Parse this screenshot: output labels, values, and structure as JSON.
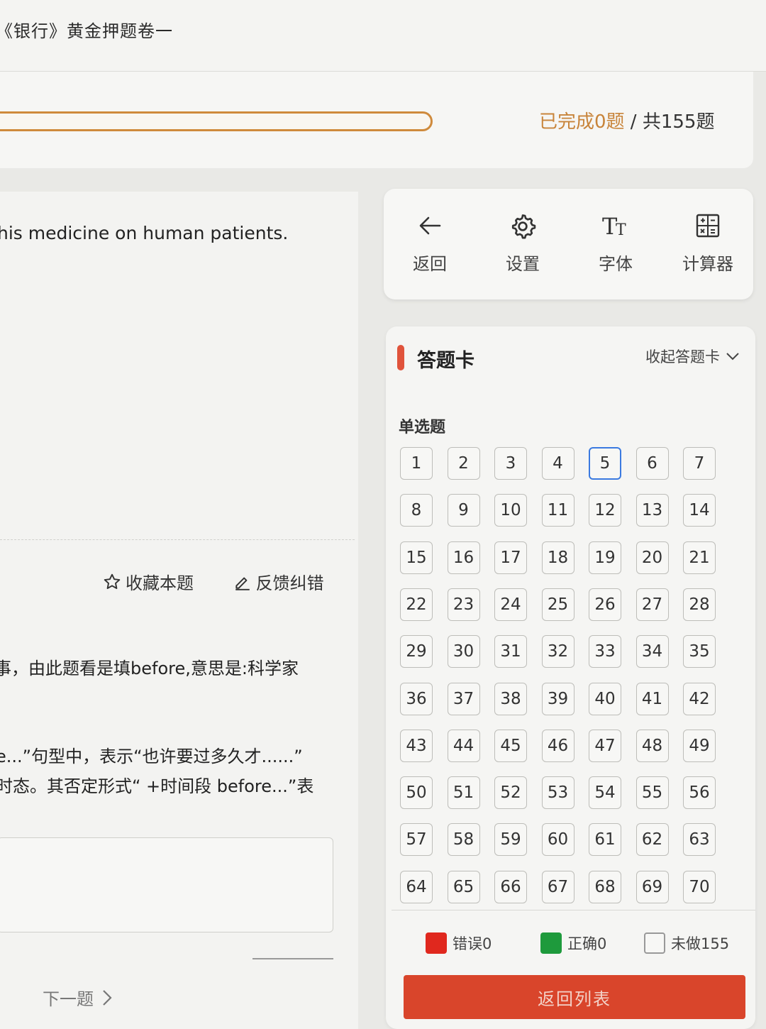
{
  "header": {
    "title": "《银行》黄金押题卷一"
  },
  "progress": {
    "done_text": "已完成0题",
    "total_text": " / 共155题",
    "fraction": 0
  },
  "question": {
    "text": "his medicine on human patients."
  },
  "actions": {
    "favorite_label": "收藏本题",
    "feedback_label": "反馈纠错"
  },
  "explanation": {
    "line1": "事，由此题看是填before,意思是:科学家",
    "line2": "e...”句型中，表示“也许要过多久才......”",
    "line3": "时态。其否定形式“ +时间段 before...”表"
  },
  "nav": {
    "next_label": "下一题"
  },
  "toolbar": {
    "back": "返回",
    "settings": "设置",
    "font": "字体",
    "calculator": "计算器"
  },
  "answer_card": {
    "title": "答题卡",
    "collapse_label": "收起答题卡",
    "section_label": "单选题",
    "current": 5,
    "questions": [
      "1",
      "2",
      "3",
      "4",
      "5",
      "6",
      "7",
      "8",
      "9",
      "10",
      "11",
      "12",
      "13",
      "14",
      "15",
      "16",
      "17",
      "18",
      "19",
      "20",
      "21",
      "22",
      "23",
      "24",
      "25",
      "26",
      "27",
      "28",
      "29",
      "30",
      "31",
      "32",
      "33",
      "34",
      "35",
      "36",
      "37",
      "38",
      "39",
      "40",
      "41",
      "42",
      "43",
      "44",
      "45",
      "46",
      "47",
      "48",
      "49",
      "50",
      "51",
      "52",
      "53",
      "54",
      "55",
      "56",
      "57",
      "58",
      "59",
      "60",
      "61",
      "62",
      "63",
      "64",
      "65",
      "66",
      "67",
      "68",
      "69",
      "70"
    ]
  },
  "legend": {
    "wrong": "错误0",
    "correct": "正确0",
    "undone": "未做155",
    "wrong_color": "#e0281e",
    "correct_color": "#1e9a3c"
  },
  "footer": {
    "return_list_label": "返回列表"
  },
  "colors": {
    "accent": "#cf8a3c",
    "primary_red": "#d9452b",
    "current_border": "#3b7ae0"
  }
}
